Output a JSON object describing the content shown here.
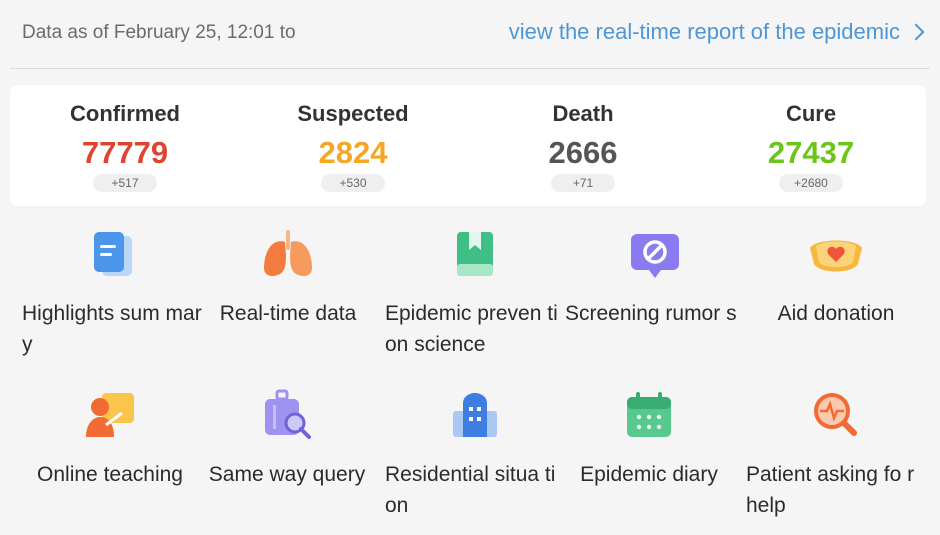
{
  "header": {
    "as_of": "Data as of February 25, 12:01 to",
    "report_link": "view the real-time report of the epidemic"
  },
  "stats": [
    {
      "label": "Confirmed",
      "value": "77779",
      "delta": "+517",
      "color": "#e0432f"
    },
    {
      "label": "Suspected",
      "value": "2824",
      "delta": "+530",
      "color": "#f5a623"
    },
    {
      "label": "Death",
      "value": "2666",
      "delta": "+71",
      "color": "#555555"
    },
    {
      "label": "Cure",
      "value": "27437",
      "delta": "+2680",
      "color": "#6cc51a"
    }
  ],
  "services": [
    {
      "label": "Highlights sum mary",
      "icon": "document-icon"
    },
    {
      "label": "Real-time data",
      "icon": "lungs-icon"
    },
    {
      "label": "Epidemic preven tion science",
      "icon": "book-icon"
    },
    {
      "label": "Screening rumor s",
      "icon": "prohibit-icon"
    },
    {
      "label": "Aid donation",
      "icon": "mask-heart-icon"
    },
    {
      "label": "Online teaching",
      "icon": "teacher-icon"
    },
    {
      "label": "Same way query",
      "icon": "luggage-search-icon"
    },
    {
      "label": "Residential situa tion",
      "icon": "building-icon"
    },
    {
      "label": "Epidemic diary",
      "icon": "calendar-icon"
    },
    {
      "label": "Patient asking fo r help",
      "icon": "help-search-icon"
    }
  ]
}
